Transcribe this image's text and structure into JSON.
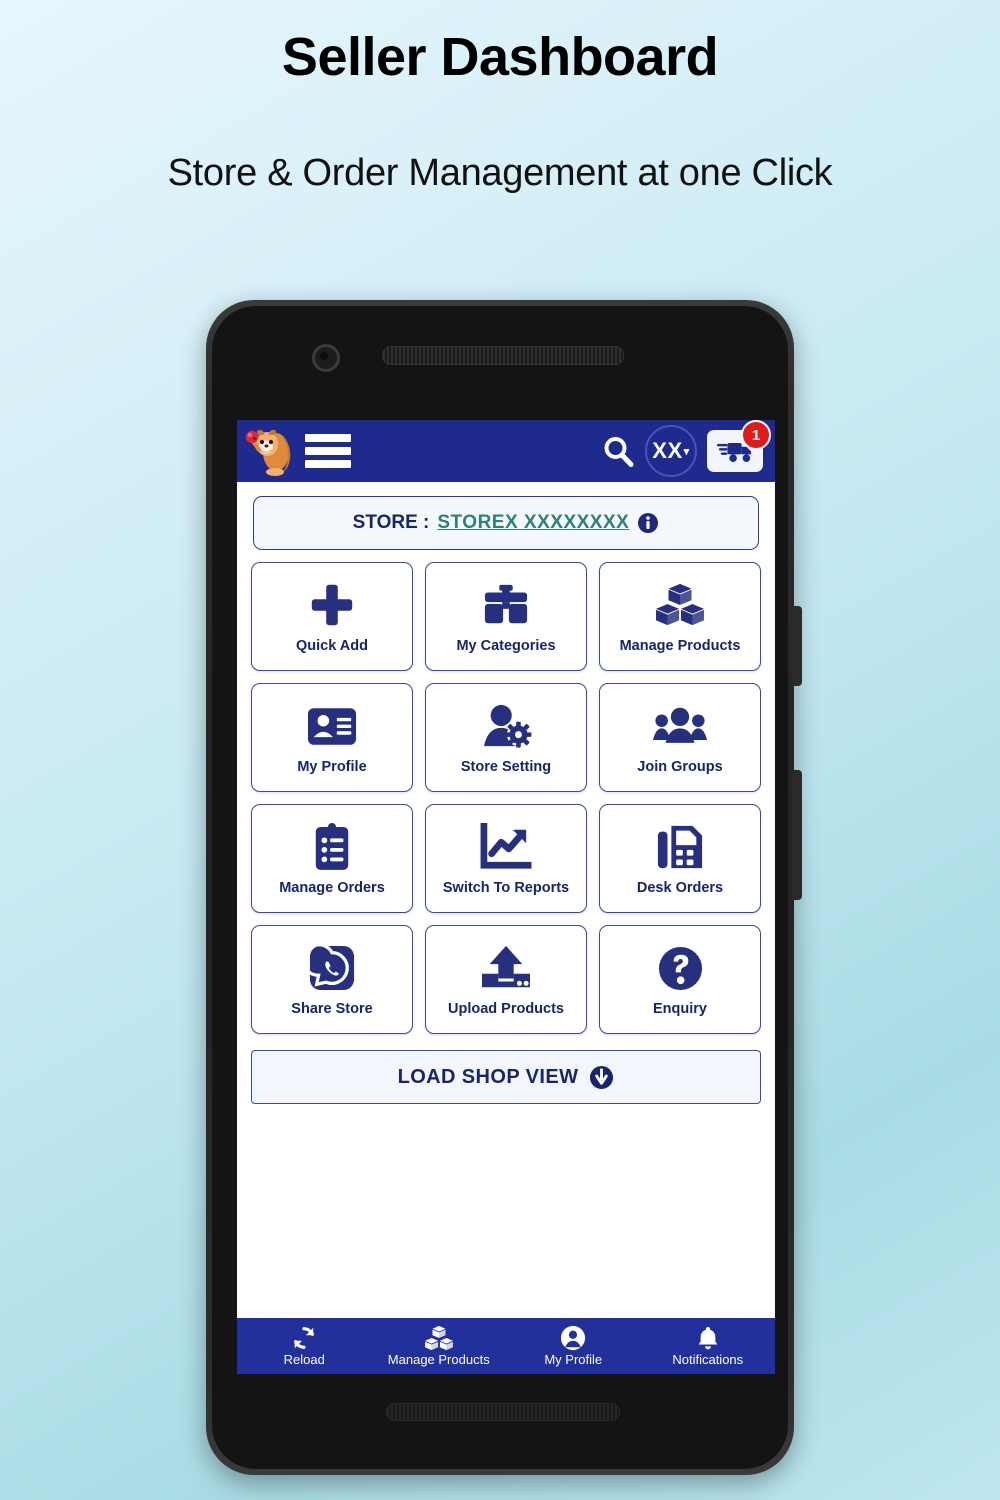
{
  "promo": {
    "title": "Seller Dashboard",
    "subtitle": "Store & Order Management at one Click"
  },
  "colors": {
    "appbar_navy": "#1f2a8f",
    "bottomnav_navy": "#22309b",
    "icon_navy": "#26307e",
    "text_navy": "#17256b",
    "store_name_teal": "#2e8176",
    "badge_red": "#e01b1b",
    "tile_border": "#3a4aa0",
    "page_bg_top": "#e6f6fc",
    "page_bg_bottom": "#a9dbe4"
  },
  "appbar": {
    "logo_icon": "squirrel-mascot-icon",
    "menu_icon": "hamburger-menu-icon",
    "search_icon": "search-icon",
    "account_label": "XX",
    "account_caret_icon": "chevron-down-icon",
    "delivery_icon": "delivery-truck-icon",
    "delivery_badge_count": "1"
  },
  "store_bar": {
    "label": "STORE :",
    "name": "STOREX   XXXXXXXX",
    "info_icon": "info-circle-icon"
  },
  "grid": {
    "tiles": [
      {
        "label": "Quick Add",
        "icon": "plus-icon"
      },
      {
        "label": "My Categories",
        "icon": "briefcase-icon"
      },
      {
        "label": "Manage Products",
        "icon": "boxes-icon"
      },
      {
        "label": "My Profile",
        "icon": "id-card-icon"
      },
      {
        "label": "Store Setting",
        "icon": "user-gear-icon"
      },
      {
        "label": "Join Groups",
        "icon": "group-people-icon"
      },
      {
        "label": "Manage Orders",
        "icon": "clipboard-list-icon"
      },
      {
        "label": "Switch To Reports",
        "icon": "chart-trend-icon"
      },
      {
        "label": "Desk Orders",
        "icon": "desk-calculator-icon"
      },
      {
        "label": "Share Store",
        "icon": "whatsapp-icon"
      },
      {
        "label": "Upload Products",
        "icon": "upload-arrow-icon"
      },
      {
        "label": "Enquiry",
        "icon": "question-circle-icon"
      }
    ]
  },
  "load_shop": {
    "label": "LOAD SHOP VIEW",
    "icon": "arrow-down-circle-icon"
  },
  "bottom_nav": {
    "items": [
      {
        "label": "Reload",
        "icon": "refresh-icon"
      },
      {
        "label": "Manage Products",
        "icon": "boxes-icon"
      },
      {
        "label": "My Profile",
        "icon": "user-circle-icon"
      },
      {
        "label": "Notifications",
        "icon": "bell-icon"
      }
    ]
  }
}
